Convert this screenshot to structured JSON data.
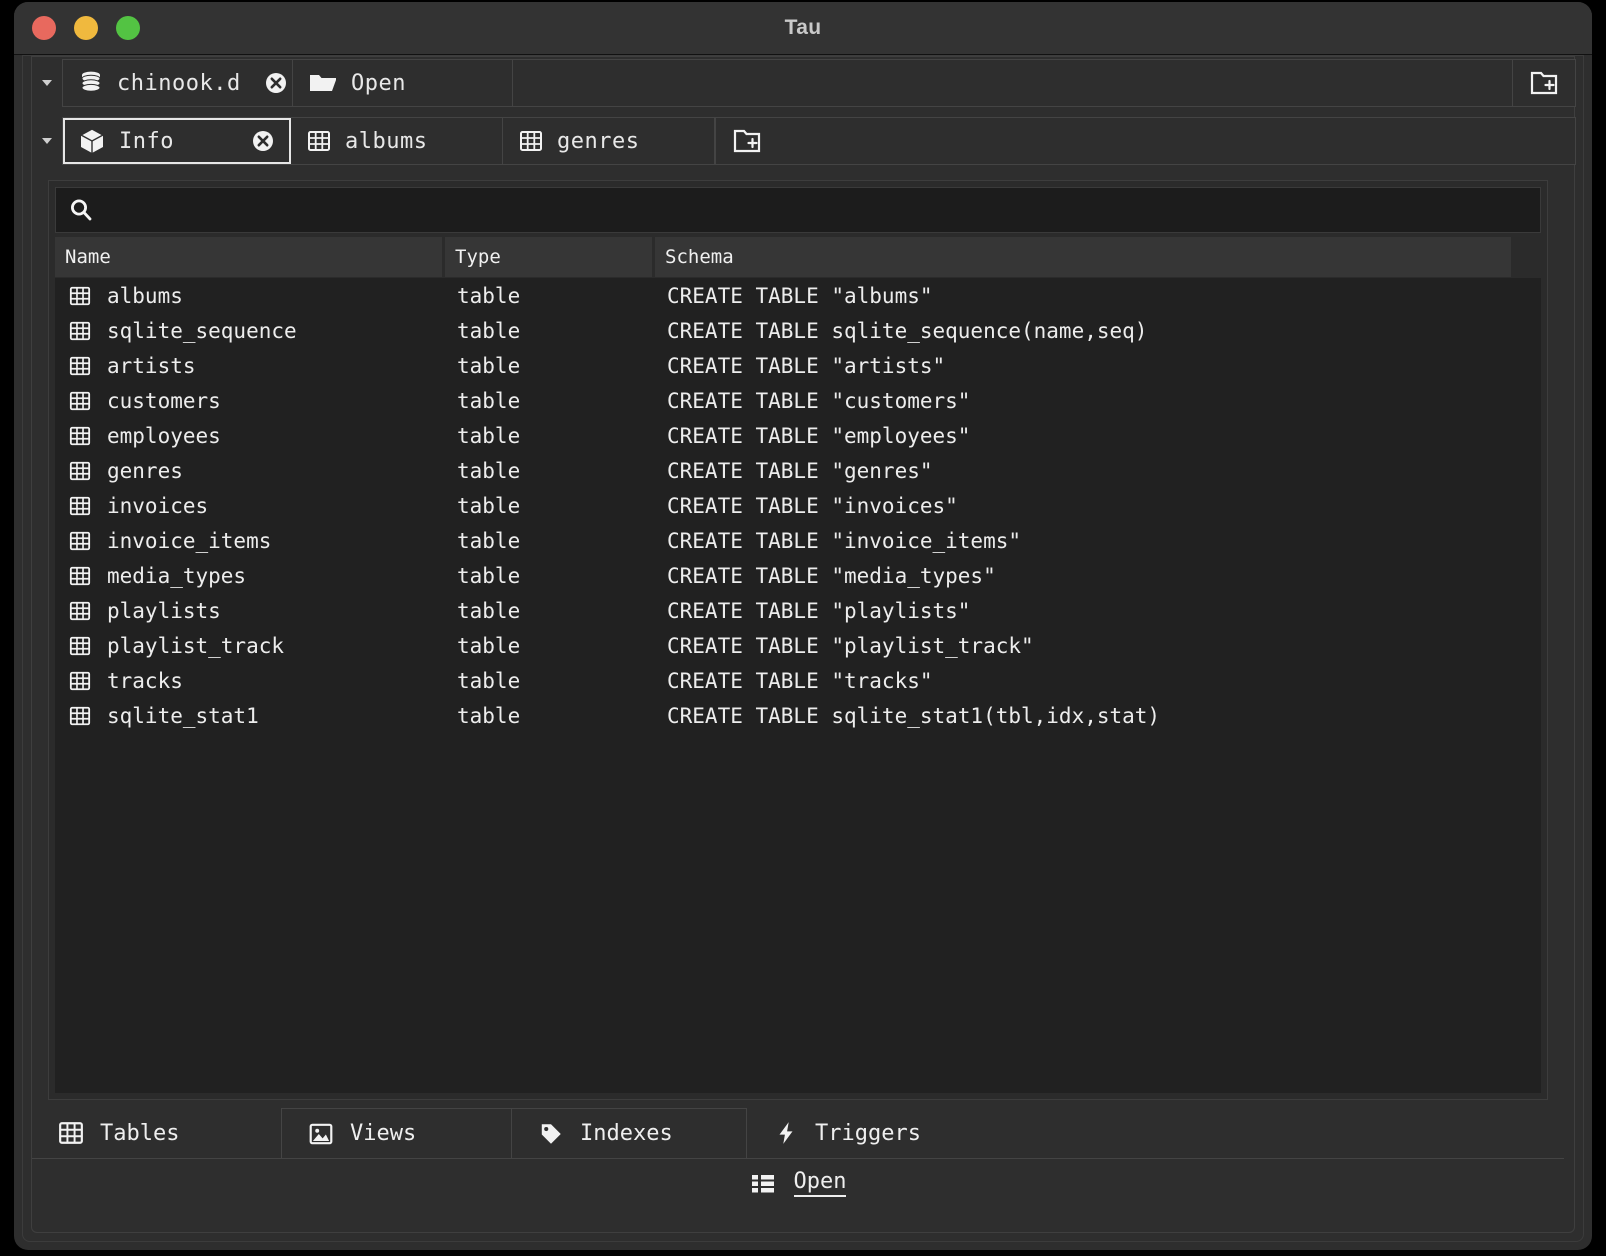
{
  "window": {
    "title": "Tau",
    "controls": [
      {
        "name": "close",
        "color": "#e8695e"
      },
      {
        "name": "minimize",
        "color": "#f0b93e"
      },
      {
        "name": "maximize",
        "color": "#53c343"
      }
    ]
  },
  "database_tabs": {
    "dropdown_icon": "chevron-down-icon",
    "items": [
      {
        "label": "chinook.d",
        "icon": "database-icon",
        "closable": true,
        "selected": false
      },
      {
        "label": "Open",
        "icon": "folder-open-icon",
        "closable": false,
        "selected": false
      }
    ],
    "add_button_icon": "folder-add-icon"
  },
  "object_tabs": {
    "dropdown_icon": "chevron-down-icon",
    "items": [
      {
        "label": "Info",
        "icon": "cube-icon",
        "closable": true,
        "selected": true
      },
      {
        "label": "albums",
        "icon": "grid-table-icon",
        "closable": false,
        "selected": false
      },
      {
        "label": "genres",
        "icon": "grid-table-icon",
        "closable": false,
        "selected": false
      }
    ],
    "add_button_icon": "folder-add-icon"
  },
  "search": {
    "icon": "search-icon",
    "value": "",
    "placeholder": ""
  },
  "table": {
    "columns": [
      "Name",
      "Type",
      "Schema"
    ],
    "row_icon": "grid-table-icon",
    "rows": [
      {
        "name": "albums",
        "type": "table",
        "schema": "CREATE TABLE \"albums\""
      },
      {
        "name": "sqlite_sequence",
        "type": "table",
        "schema": "CREATE TABLE sqlite_sequence(name,seq)"
      },
      {
        "name": "artists",
        "type": "table",
        "schema": "CREATE TABLE \"artists\""
      },
      {
        "name": "customers",
        "type": "table",
        "schema": "CREATE TABLE \"customers\""
      },
      {
        "name": "employees",
        "type": "table",
        "schema": "CREATE TABLE \"employees\""
      },
      {
        "name": "genres",
        "type": "table",
        "schema": "CREATE TABLE \"genres\""
      },
      {
        "name": "invoices",
        "type": "table",
        "schema": "CREATE TABLE \"invoices\""
      },
      {
        "name": "invoice_items",
        "type": "table",
        "schema": "CREATE TABLE \"invoice_items\""
      },
      {
        "name": "media_types",
        "type": "table",
        "schema": "CREATE TABLE \"media_types\""
      },
      {
        "name": "playlists",
        "type": "table",
        "schema": "CREATE TABLE \"playlists\""
      },
      {
        "name": "playlist_track",
        "type": "table",
        "schema": "CREATE TABLE \"playlist_track\""
      },
      {
        "name": "tracks",
        "type": "table",
        "schema": "CREATE TABLE \"tracks\""
      },
      {
        "name": "sqlite_stat1",
        "type": "table",
        "schema": "CREATE TABLE sqlite_stat1(tbl,idx,stat)"
      }
    ]
  },
  "bottom_tabs": {
    "items": [
      {
        "label": "Tables",
        "icon": "grid-table-icon",
        "selected": true
      },
      {
        "label": "Views",
        "icon": "image-icon",
        "selected": false
      },
      {
        "label": "Indexes",
        "icon": "tag-icon",
        "selected": false
      },
      {
        "label": "Triggers",
        "icon": "lightning-icon",
        "selected": false
      }
    ]
  },
  "status_bar": {
    "open_label": "Open",
    "open_icon": "list-icon"
  },
  "colors": {
    "window_bg": "#2e2e2e",
    "titlebar": "#333333",
    "content_bg": "#2b2b2b",
    "rows_bg": "#212121",
    "search_bg": "#1c1c1c",
    "header_bg": "#363636",
    "text": "#ededed",
    "border": "#444444"
  }
}
